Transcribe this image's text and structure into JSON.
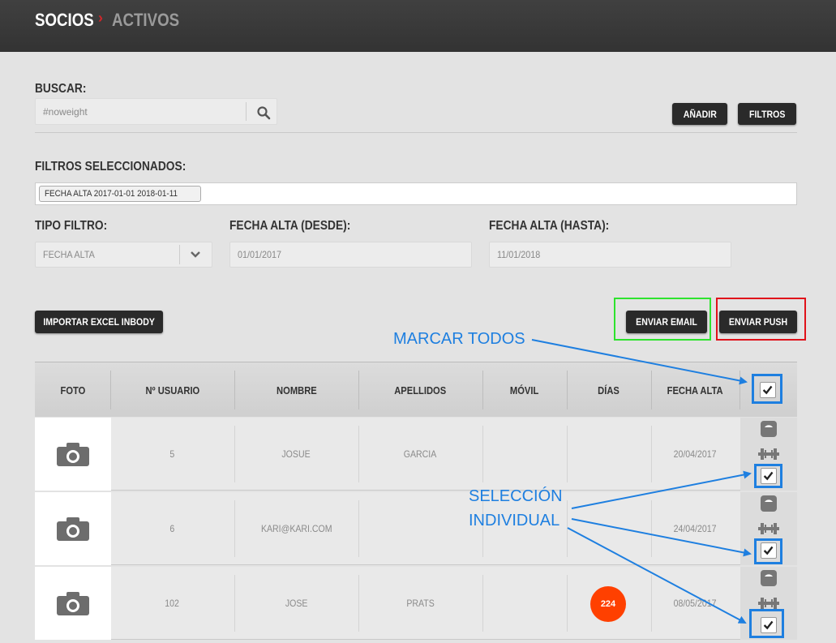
{
  "header": {
    "section": "SOCIOS",
    "separator": "›",
    "subsection": "ACTIVOS"
  },
  "search": {
    "label": "BUSCAR:",
    "value": "#noweight"
  },
  "toolbar": {
    "add_label": "AÑADIR",
    "filters_label": "FILTROS"
  },
  "selected_filters": {
    "label": "FILTROS SELECCIONADOS:",
    "chip": "FECHA ALTA 2017-01-01 2018-01-11"
  },
  "filter_form": {
    "type_label": "TIPO FILTRO:",
    "type_value": "FECHA ALTA",
    "from_label": "FECHA ALTA (DESDE):",
    "from_value": "01/01/2017",
    "to_label": "FECHA ALTA (HASTA):",
    "to_value": "11/01/2018"
  },
  "actions": {
    "import_label": "IMPORTAR EXCEL INBODY",
    "email_label": "ENVIAR EMAIL",
    "push_label": "ENVIAR PUSH"
  },
  "annotations": {
    "mark_all": "MARCAR TODOS",
    "individual_1": "SELECCIÓN",
    "individual_2": "INDIVIDUAL"
  },
  "table": {
    "columns": [
      "FOTO",
      "Nº USUARIO",
      "NOMBRE",
      "APELLIDOS",
      "MÓVIL",
      "DÍAS",
      "FECHA ALTA"
    ],
    "rows": [
      {
        "user_no": "5",
        "name": "JOSUE",
        "surname": "GARCIA",
        "mobile": "",
        "days": "",
        "date": "20/04/2017"
      },
      {
        "user_no": "6",
        "name": "KARI@KARI.COM",
        "surname": "",
        "mobile": "",
        "days": "",
        "date": "24/04/2017"
      },
      {
        "user_no": "102",
        "name": "JOSE",
        "surname": "PRATS",
        "mobile": "",
        "days": "224",
        "date": "08/05/2017"
      }
    ]
  },
  "colors": {
    "annotation_blue": "#1e7fe0",
    "badge": "#ff4000",
    "email_highlight": "#2ee32e",
    "push_highlight": "#e0121a"
  }
}
